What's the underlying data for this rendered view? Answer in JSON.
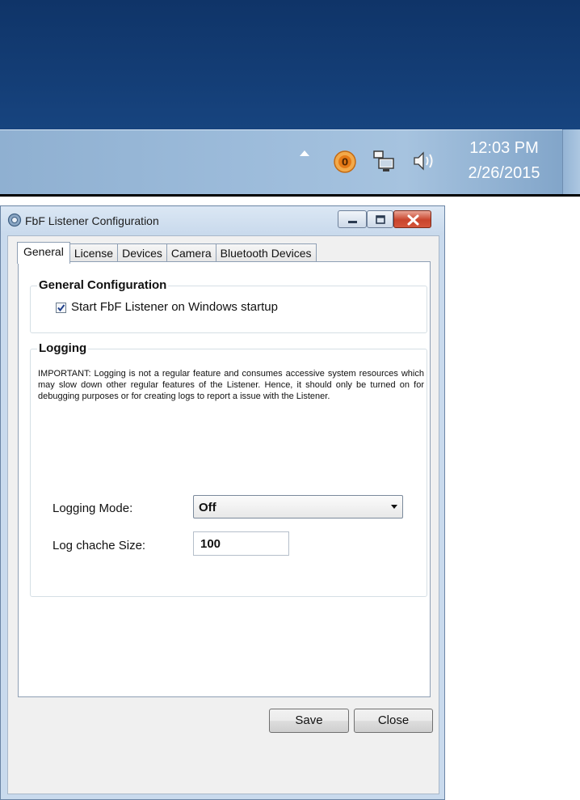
{
  "taskbar": {
    "tray_icons": [
      "show-hidden-icons-arrow",
      "fbf-listener-tray-icon",
      "network-icon",
      "volume-icon"
    ],
    "clock_time": "12:03 PM",
    "clock_date": "2/26/2015"
  },
  "window": {
    "title": "FbF Listener Configuration",
    "tabs": [
      {
        "label": "General",
        "active": true
      },
      {
        "label": "License",
        "active": false
      },
      {
        "label": "Devices",
        "active": false
      },
      {
        "label": "Camera",
        "active": false
      },
      {
        "label": "Bluetooth Devices",
        "active": false
      }
    ],
    "general_group": {
      "title": "General Configuration",
      "startup_checkbox_label": "Start FbF Listener on Windows startup",
      "startup_checked": true
    },
    "logging_group": {
      "title": "Logging",
      "notice": "IMPORTANT: Logging is not a regular feature and consumes accessive system resources which may slow down other regular features of the Listener. Hence, it should only be turned on for debugging purposes or for creating logs to report a issue with the Listener.",
      "mode_label": "Logging Mode:",
      "mode_value": "Off",
      "cache_label": "Log chache Size:",
      "cache_value": "100"
    },
    "buttons": {
      "save": "Save",
      "close": "Close"
    }
  },
  "colors": {
    "desktop": "#143d73",
    "taskbar": "#9dbcdb",
    "window_frame": "#c9daed",
    "close_button": "#c9442c"
  }
}
